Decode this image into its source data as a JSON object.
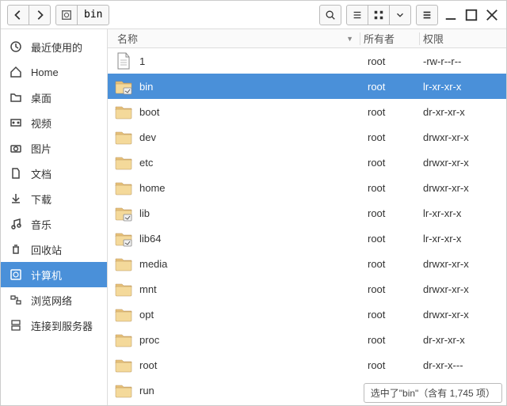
{
  "path_segment": "bin",
  "columns": {
    "name": "名称",
    "owner": "所有者",
    "perm": "权限"
  },
  "sidebar": {
    "items": [
      {
        "label": "最近使用的",
        "icon": "clock"
      },
      {
        "label": "Home",
        "icon": "home"
      },
      {
        "label": "桌面",
        "icon": "folder"
      },
      {
        "label": "视频",
        "icon": "video"
      },
      {
        "label": "图片",
        "icon": "camera"
      },
      {
        "label": "文档",
        "icon": "doc"
      },
      {
        "label": "下载",
        "icon": "download"
      },
      {
        "label": "音乐",
        "icon": "music"
      },
      {
        "label": "回收站",
        "icon": "trash"
      },
      {
        "label": "计算机",
        "icon": "disk",
        "selected": true
      },
      {
        "label": "浏览网络",
        "icon": "network"
      },
      {
        "label": "连接到服务器",
        "icon": "server"
      }
    ]
  },
  "files": [
    {
      "name": "1",
      "owner": "root",
      "perm": "-rw-r--r--",
      "type": "file"
    },
    {
      "name": "bin",
      "owner": "root",
      "perm": "lr-xr-xr-x",
      "type": "link",
      "selected": true
    },
    {
      "name": "boot",
      "owner": "root",
      "perm": "dr-xr-xr-x",
      "type": "folder"
    },
    {
      "name": "dev",
      "owner": "root",
      "perm": "drwxr-xr-x",
      "type": "folder"
    },
    {
      "name": "etc",
      "owner": "root",
      "perm": "drwxr-xr-x",
      "type": "folder"
    },
    {
      "name": "home",
      "owner": "root",
      "perm": "drwxr-xr-x",
      "type": "folder"
    },
    {
      "name": "lib",
      "owner": "root",
      "perm": "lr-xr-xr-x",
      "type": "link"
    },
    {
      "name": "lib64",
      "owner": "root",
      "perm": "lr-xr-xr-x",
      "type": "link"
    },
    {
      "name": "media",
      "owner": "root",
      "perm": "drwxr-xr-x",
      "type": "folder"
    },
    {
      "name": "mnt",
      "owner": "root",
      "perm": "drwxr-xr-x",
      "type": "folder"
    },
    {
      "name": "opt",
      "owner": "root",
      "perm": "drwxr-xr-x",
      "type": "folder"
    },
    {
      "name": "proc",
      "owner": "root",
      "perm": "dr-xr-xr-x",
      "type": "folder"
    },
    {
      "name": "root",
      "owner": "root",
      "perm": "dr-xr-x---",
      "type": "folder"
    },
    {
      "name": "run",
      "owner": "",
      "perm": "",
      "type": "folder"
    }
  ],
  "status": "选中了\"bin\"（含有 1,745 项）"
}
